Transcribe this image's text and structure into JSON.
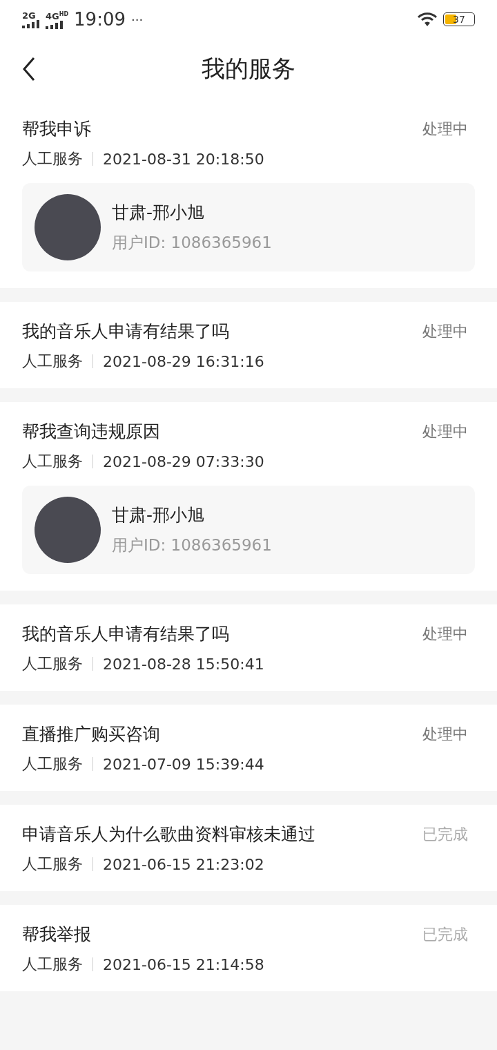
{
  "status_bar": {
    "time": "19:09",
    "signal_1": "2G",
    "signal_2": "4G",
    "signal_2_badge": "HD",
    "more": "···",
    "battery": "37"
  },
  "header": {
    "title": "我的服务"
  },
  "services": [
    {
      "title": "帮我申诉",
      "status": "处理中",
      "completed": false,
      "type": "人工服务",
      "time": "2021-08-31 20:18:50",
      "user": {
        "name": "甘肃-邢小旭",
        "id": "用户ID: 1086365961"
      }
    },
    {
      "title": "我的音乐人申请有结果了吗",
      "status": "处理中",
      "completed": false,
      "type": "人工服务",
      "time": "2021-08-29 16:31:16"
    },
    {
      "title": "帮我查询违规原因",
      "status": "处理中",
      "completed": false,
      "type": "人工服务",
      "time": "2021-08-29 07:33:30",
      "user": {
        "name": "甘肃-邢小旭",
        "id": "用户ID: 1086365961"
      }
    },
    {
      "title": "我的音乐人申请有结果了吗",
      "status": "处理中",
      "completed": false,
      "type": "人工服务",
      "time": "2021-08-28 15:50:41"
    },
    {
      "title": "直播推广购买咨询",
      "status": "处理中",
      "completed": false,
      "type": "人工服务",
      "time": "2021-07-09 15:39:44"
    },
    {
      "title": "申请音乐人为什么歌曲资料审核未通过",
      "status": "已完成",
      "completed": true,
      "type": "人工服务",
      "time": "2021-06-15 21:23:02"
    },
    {
      "title": "帮我举报",
      "status": "已完成",
      "completed": true,
      "type": "人工服务",
      "time": "2021-06-15 21:14:58"
    }
  ]
}
